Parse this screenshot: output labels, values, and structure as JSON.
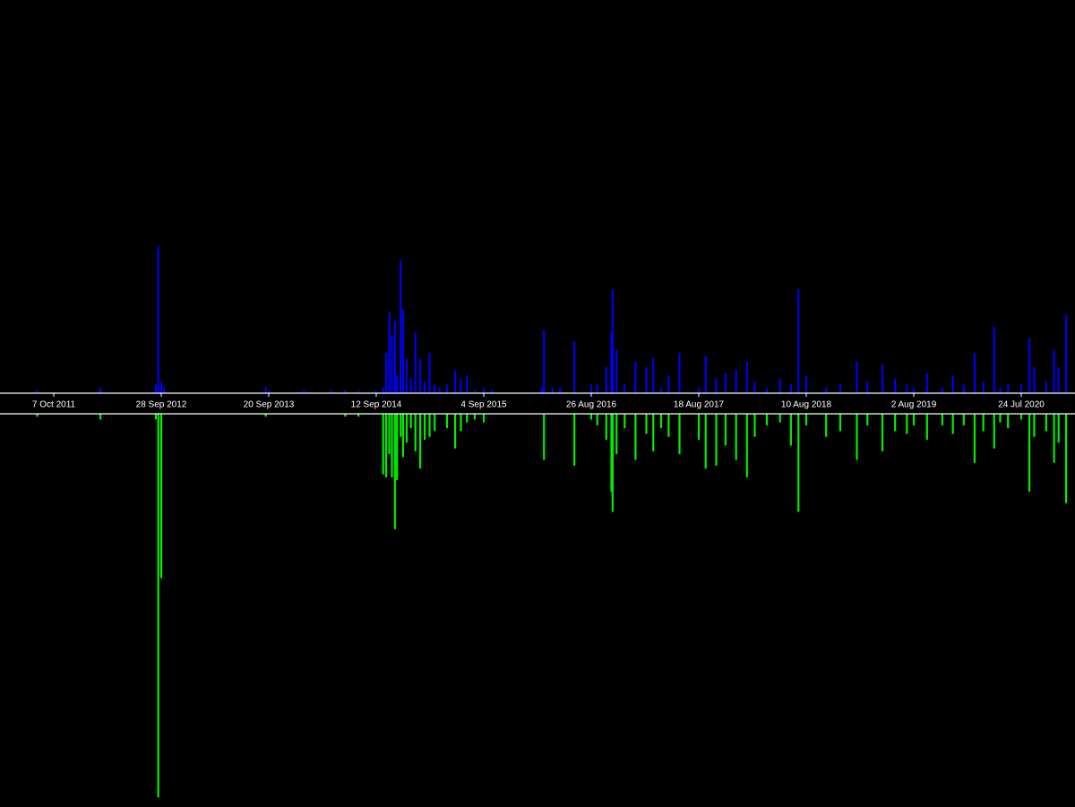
{
  "chart_data": {
    "type": "bar",
    "title": "",
    "xlabel": "",
    "ylabel": "",
    "axis": {
      "tick_labels": [
        "7 Oct 2011",
        "28 Sep 2012",
        "20 Sep 2013",
        "12 Sep 2014",
        "4 Sep 2015",
        "26 Aug 2016",
        "18 Aug 2017",
        "10 Aug 2018",
        "2 Aug 2019",
        "24 Jul 2020"
      ]
    },
    "colors": {
      "background": "#000000",
      "axis": "#ffffff",
      "up": "#0000ee",
      "down": "#00ee00"
    },
    "series": [
      {
        "direction": "up",
        "values": [
          {
            "x": "2011-08-13",
            "v": 1
          },
          {
            "x": "2012-03-10",
            "v": 2
          },
          {
            "x": "2012-09-10",
            "v": 3
          },
          {
            "x": "2012-09-18",
            "v": 51
          },
          {
            "x": "2012-09-28",
            "v": 4
          },
          {
            "x": "2012-10-08",
            "v": 2
          },
          {
            "x": "2013-09-10",
            "v": 2
          },
          {
            "x": "2013-09-20",
            "v": 1
          },
          {
            "x": "2014-01-15",
            "v": 1
          },
          {
            "x": "2014-04-15",
            "v": 1
          },
          {
            "x": "2014-06-01",
            "v": 1
          },
          {
            "x": "2014-07-15",
            "v": 1
          },
          {
            "x": "2014-09-10",
            "v": 1
          },
          {
            "x": "2014-10-05",
            "v": 2
          },
          {
            "x": "2014-10-15",
            "v": 14
          },
          {
            "x": "2014-10-25",
            "v": 28
          },
          {
            "x": "2014-11-03",
            "v": 20
          },
          {
            "x": "2014-11-13",
            "v": 25
          },
          {
            "x": "2014-11-20",
            "v": 6
          },
          {
            "x": "2014-12-02",
            "v": 46
          },
          {
            "x": "2014-12-10",
            "v": 29
          },
          {
            "x": "2014-12-22",
            "v": 12
          },
          {
            "x": "2015-01-05",
            "v": 5
          },
          {
            "x": "2015-01-20",
            "v": 21
          },
          {
            "x": "2015-02-05",
            "v": 12
          },
          {
            "x": "2015-02-20",
            "v": 4
          },
          {
            "x": "2015-03-08",
            "v": 14
          },
          {
            "x": "2015-03-25",
            "v": 3
          },
          {
            "x": "2015-04-10",
            "v": 2
          },
          {
            "x": "2015-05-05",
            "v": 3
          },
          {
            "x": "2015-06-01",
            "v": 8
          },
          {
            "x": "2015-06-20",
            "v": 5
          },
          {
            "x": "2015-07-10",
            "v": 6
          },
          {
            "x": "2015-08-05",
            "v": 1
          },
          {
            "x": "2015-09-04",
            "v": 2
          },
          {
            "x": "2015-10-01",
            "v": 1
          },
          {
            "x": "2016-03-15",
            "v": 2
          },
          {
            "x": "2016-03-22",
            "v": 22
          },
          {
            "x": "2016-04-20",
            "v": 2
          },
          {
            "x": "2016-05-15",
            "v": 2
          },
          {
            "x": "2016-07-01",
            "v": 18
          },
          {
            "x": "2016-08-26",
            "v": 3
          },
          {
            "x": "2016-09-15",
            "v": 3
          },
          {
            "x": "2016-10-15",
            "v": 9
          },
          {
            "x": "2016-11-01",
            "v": 21
          },
          {
            "x": "2016-11-05",
            "v": 36
          },
          {
            "x": "2016-11-18",
            "v": 15
          },
          {
            "x": "2016-12-15",
            "v": 3
          },
          {
            "x": "2017-01-20",
            "v": 11
          },
          {
            "x": "2017-02-25",
            "v": 9
          },
          {
            "x": "2017-03-20",
            "v": 12
          },
          {
            "x": "2017-04-15",
            "v": 2
          },
          {
            "x": "2017-05-10",
            "v": 6
          },
          {
            "x": "2017-06-15",
            "v": 14
          },
          {
            "x": "2017-08-18",
            "v": 2
          },
          {
            "x": "2017-09-10",
            "v": 13
          },
          {
            "x": "2017-10-15",
            "v": 5
          },
          {
            "x": "2017-11-15",
            "v": 7
          },
          {
            "x": "2017-12-20",
            "v": 8
          },
          {
            "x": "2018-01-25",
            "v": 11
          },
          {
            "x": "2018-02-20",
            "v": 4
          },
          {
            "x": "2018-04-01",
            "v": 2
          },
          {
            "x": "2018-05-15",
            "v": 5
          },
          {
            "x": "2018-06-20",
            "v": 3
          },
          {
            "x": "2018-07-15",
            "v": 36
          },
          {
            "x": "2018-08-10",
            "v": 6
          },
          {
            "x": "2018-10-15",
            "v": 2
          },
          {
            "x": "2018-12-01",
            "v": 3
          },
          {
            "x": "2019-01-25",
            "v": 11
          },
          {
            "x": "2019-03-01",
            "v": 4
          },
          {
            "x": "2019-04-20",
            "v": 10
          },
          {
            "x": "2019-06-01",
            "v": 5
          },
          {
            "x": "2019-07-10",
            "v": 3
          },
          {
            "x": "2019-08-02",
            "v": 2
          },
          {
            "x": "2019-09-15",
            "v": 7
          },
          {
            "x": "2019-11-05",
            "v": 2
          },
          {
            "x": "2019-12-10",
            "v": 6
          },
          {
            "x": "2020-01-15",
            "v": 3
          },
          {
            "x": "2020-02-20",
            "v": 14
          },
          {
            "x": "2020-03-20",
            "v": 4
          },
          {
            "x": "2020-04-25",
            "v": 23
          },
          {
            "x": "2020-05-15",
            "v": 2
          },
          {
            "x": "2020-06-10",
            "v": 3
          },
          {
            "x": "2020-07-24",
            "v": 3
          },
          {
            "x": "2020-08-20",
            "v": 19
          },
          {
            "x": "2020-09-05",
            "v": 9
          },
          {
            "x": "2020-10-15",
            "v": 4
          },
          {
            "x": "2020-11-10",
            "v": 15
          },
          {
            "x": "2020-11-25",
            "v": 9
          },
          {
            "x": "2020-12-20",
            "v": 27
          },
          {
            "x": "2021-01-20",
            "v": 9
          }
        ]
      },
      {
        "direction": "down",
        "values": [
          {
            "x": "2011-08-13",
            "v": 1
          },
          {
            "x": "2012-03-10",
            "v": 2
          },
          {
            "x": "2012-09-10",
            "v": 2
          },
          {
            "x": "2012-09-18",
            "v": 133
          },
          {
            "x": "2012-09-28",
            "v": 57
          },
          {
            "x": "2013-09-10",
            "v": 1
          },
          {
            "x": "2014-06-01",
            "v": 1
          },
          {
            "x": "2014-07-15",
            "v": 1
          },
          {
            "x": "2014-10-05",
            "v": 21
          },
          {
            "x": "2014-10-15",
            "v": 22
          },
          {
            "x": "2014-10-25",
            "v": 14
          },
          {
            "x": "2014-11-03",
            "v": 22
          },
          {
            "x": "2014-11-13",
            "v": 40
          },
          {
            "x": "2014-11-20",
            "v": 23
          },
          {
            "x": "2014-12-02",
            "v": 8
          },
          {
            "x": "2014-12-10",
            "v": 15
          },
          {
            "x": "2014-12-22",
            "v": 10
          },
          {
            "x": "2015-01-05",
            "v": 5
          },
          {
            "x": "2015-01-20",
            "v": 13
          },
          {
            "x": "2015-02-05",
            "v": 19
          },
          {
            "x": "2015-02-20",
            "v": 9
          },
          {
            "x": "2015-03-08",
            "v": 8
          },
          {
            "x": "2015-03-25",
            "v": 6
          },
          {
            "x": "2015-05-05",
            "v": 5
          },
          {
            "x": "2015-06-01",
            "v": 12
          },
          {
            "x": "2015-06-20",
            "v": 6
          },
          {
            "x": "2015-07-10",
            "v": 3
          },
          {
            "x": "2015-08-05",
            "v": 2
          },
          {
            "x": "2015-09-04",
            "v": 3
          },
          {
            "x": "2016-03-22",
            "v": 16
          },
          {
            "x": "2016-07-01",
            "v": 18
          },
          {
            "x": "2016-08-26",
            "v": 2
          },
          {
            "x": "2016-09-15",
            "v": 4
          },
          {
            "x": "2016-10-15",
            "v": 9
          },
          {
            "x": "2016-11-01",
            "v": 27
          },
          {
            "x": "2016-11-05",
            "v": 34
          },
          {
            "x": "2016-11-18",
            "v": 14
          },
          {
            "x": "2016-12-15",
            "v": 5
          },
          {
            "x": "2017-01-20",
            "v": 16
          },
          {
            "x": "2017-02-25",
            "v": 7
          },
          {
            "x": "2017-03-20",
            "v": 13
          },
          {
            "x": "2017-04-15",
            "v": 5
          },
          {
            "x": "2017-05-10",
            "v": 8
          },
          {
            "x": "2017-06-15",
            "v": 14
          },
          {
            "x": "2017-08-18",
            "v": 9
          },
          {
            "x": "2017-09-10",
            "v": 19
          },
          {
            "x": "2017-10-15",
            "v": 18
          },
          {
            "x": "2017-11-15",
            "v": 11
          },
          {
            "x": "2017-12-20",
            "v": 16
          },
          {
            "x": "2018-01-25",
            "v": 22
          },
          {
            "x": "2018-02-20",
            "v": 8
          },
          {
            "x": "2018-04-01",
            "v": 4
          },
          {
            "x": "2018-05-15",
            "v": 3
          },
          {
            "x": "2018-06-20",
            "v": 11
          },
          {
            "x": "2018-07-15",
            "v": 34
          },
          {
            "x": "2018-08-10",
            "v": 4
          },
          {
            "x": "2018-10-15",
            "v": 8
          },
          {
            "x": "2018-12-01",
            "v": 6
          },
          {
            "x": "2019-01-25",
            "v": 16
          },
          {
            "x": "2019-03-01",
            "v": 4
          },
          {
            "x": "2019-04-20",
            "v": 13
          },
          {
            "x": "2019-06-01",
            "v": 6
          },
          {
            "x": "2019-07-10",
            "v": 7
          },
          {
            "x": "2019-08-02",
            "v": 4
          },
          {
            "x": "2019-09-15",
            "v": 9
          },
          {
            "x": "2019-11-05",
            "v": 4
          },
          {
            "x": "2019-12-10",
            "v": 7
          },
          {
            "x": "2020-01-15",
            "v": 4
          },
          {
            "x": "2020-02-20",
            "v": 17
          },
          {
            "x": "2020-03-20",
            "v": 6
          },
          {
            "x": "2020-04-25",
            "v": 12
          },
          {
            "x": "2020-05-15",
            "v": 3
          },
          {
            "x": "2020-06-10",
            "v": 5
          },
          {
            "x": "2020-07-24",
            "v": 2
          },
          {
            "x": "2020-08-20",
            "v": 27
          },
          {
            "x": "2020-09-05",
            "v": 8
          },
          {
            "x": "2020-10-15",
            "v": 6
          },
          {
            "x": "2020-11-10",
            "v": 17
          },
          {
            "x": "2020-11-25",
            "v": 10
          },
          {
            "x": "2020-12-20",
            "v": 31
          },
          {
            "x": "2021-01-20",
            "v": 11
          }
        ]
      }
    ]
  }
}
